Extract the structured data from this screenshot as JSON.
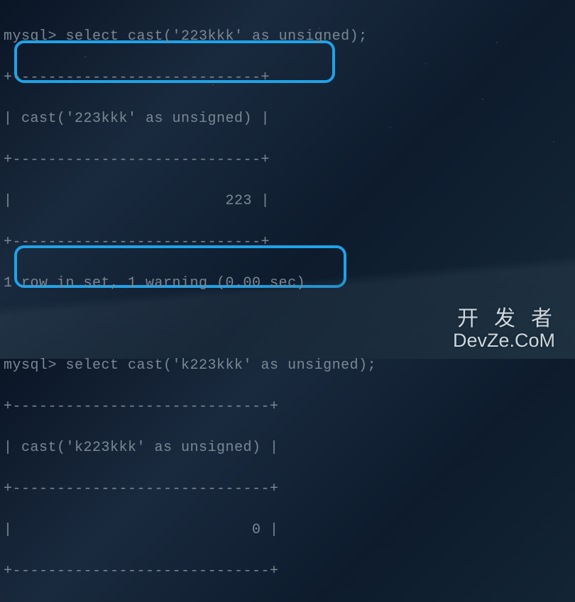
{
  "query1": {
    "prompt": "mysql> ",
    "command": "select cast('223kkk' as unsigned);",
    "border": "+----------------------------+",
    "header": "| cast('223kkk' as unsigned) |",
    "valueRow": "|                        223 |",
    "footer": "1 row in set, 1 warning (0.00 sec)"
  },
  "query2": {
    "prompt": "mysql> ",
    "command": "select cast('k223kkk' as unsigned);",
    "border": "+-----------------------------+",
    "header": "| cast('k223kkk' as unsigned) |",
    "valueRow": "|                           0 |"
  },
  "watermark": {
    "line1": "开发者",
    "line2": "DevZe.CoM"
  }
}
